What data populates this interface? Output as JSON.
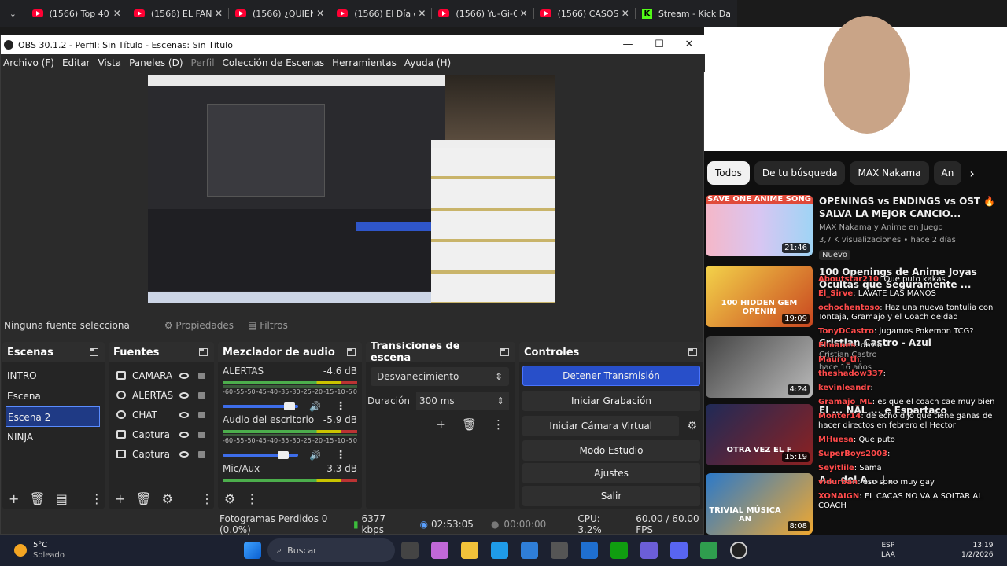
{
  "browser_tabs": [
    {
      "title": "(1566) Top 40 Op"
    },
    {
      "title": "(1566) EL FAN M"
    },
    {
      "title": "(1566) ¿QUIEN T"
    },
    {
      "title": "(1566) El Día que"
    },
    {
      "title": "(1566) Yu-Gi-Oh"
    },
    {
      "title": "(1566) CASOS O"
    },
    {
      "title": "Stream - Kick Da"
    }
  ],
  "obs": {
    "title": "OBS 30.1.2 - Perfil: Sin Título - Escenas: Sin Título",
    "menu": [
      "Archivo (F)",
      "Editar",
      "Vista",
      "Paneles (D)",
      "Perfil",
      "Colección de Escenas",
      "Herramientas",
      "Ayuda (H)"
    ],
    "no_source": "Ninguna fuente selecciona",
    "properties_label": "Propiedades",
    "filters_label": "Filtros",
    "scenes": {
      "title": "Escenas",
      "items": [
        "INTRO",
        "Escena",
        "Escena 2",
        "NINJA"
      ],
      "selected": "Escena 2"
    },
    "sources": {
      "title": "Fuentes",
      "items": [
        {
          "name": "CAMARA",
          "icon": "camera-icon"
        },
        {
          "name": "ALERTAS",
          "icon": "globe-icon"
        },
        {
          "name": "CHAT",
          "icon": "globe-icon"
        },
        {
          "name": "Captura d",
          "icon": "window-capture-icon"
        },
        {
          "name": "Captura d",
          "icon": "display-capture-icon"
        }
      ]
    },
    "mixer": {
      "title": "Mezclador de audio",
      "scale": [
        "-60",
        "-55",
        "-50",
        "-45",
        "-40",
        "-35",
        "-30",
        "-25",
        "-20",
        "-15",
        "-10",
        "-5",
        "0"
      ],
      "channels": [
        {
          "name": "ALERTAS",
          "db": "-4.6 dB",
          "level": 0.8
        },
        {
          "name": "Audio del escritorio",
          "db": "-5.9 dB",
          "level": 0.78
        },
        {
          "name": "Mic/Aux",
          "db": "-3.3 dB",
          "level": 0.0
        }
      ]
    },
    "transitions": {
      "title": "Transiciones de escena",
      "selected": "Desvanecimiento",
      "duration_label": "Duración",
      "duration_value": "300 ms"
    },
    "controls": {
      "title": "Controles",
      "buttons": [
        "Detener Transmisión",
        "Iniciar Grabación",
        "Iniciar Cámara Virtual",
        "Modo Estudio",
        "Ajustes",
        "Salir"
      ]
    },
    "status": {
      "dropped": "Fotogramas Perdidos 0 (0.0%)",
      "bitrate": "6377 kbps",
      "live_time": "02:53:05",
      "rec_time": "00:00:00",
      "cpu": "CPU: 3.2%",
      "fps": "60.00 / 60.00 FPS"
    }
  },
  "youtube": {
    "chips": [
      "Todos",
      "De tu búsqueda",
      "MAX Nakama",
      "An"
    ],
    "videos": [
      {
        "title": "OPENINGS vs ENDINGS vs OST 🔥 SALVA LA MEJOR CANCIO...",
        "channel": "MAX Nakama y Anime en Juego",
        "meta": "3,7 K visualizaciones • hace 2 días",
        "badge": "Nuevo",
        "duration": "21:46",
        "thumb_text": "SAVE ONE ANIME SONG"
      },
      {
        "title": "100 Openings de Anime Joyas Ocultas que Seguramente ...",
        "channel": "",
        "meta": "",
        "badge": "",
        "duration": "19:09",
        "thumb_text": "100 HIDDEN GEM OPENIN"
      },
      {
        "title": "Cristian Castro - Azul",
        "channel": "Cristian Castro",
        "meta": "hace 16 años",
        "badge": "",
        "duration": "4:24",
        "thumb_text": ""
      },
      {
        "title": "El ... NAL ... e Espartaco",
        "channel": "",
        "meta": "",
        "badge": "",
        "duration": "15:19",
        "thumb_text": "OTRA VEZ EL F"
      },
      {
        "title": "A... del A... | ...",
        "channel": "",
        "meta": "",
        "badge": "",
        "duration": "8:08",
        "thumb_text": "TRIVIAL MÚSICA AN"
      }
    ]
  },
  "chat": [
    {
      "user": "Aboutstar210",
      "text": "Que puto kakas"
    },
    {
      "user": "El_Sirve",
      "text": "LAVATE LAS MANOS"
    },
    {
      "user": "ochochentoso",
      "text": "Haz una nueva tontulia con Tontaja, Gramajo y el Coach deidad"
    },
    {
      "user": "TonyDCastro",
      "text": "jugamos Pokemon TCG?"
    },
    {
      "user": "Elmanes",
      "text": "obvio"
    },
    {
      "user": "Mauro_th",
      "text": ""
    },
    {
      "user": "theshadow337",
      "text": ""
    },
    {
      "user": "kevinleandr",
      "text": ""
    },
    {
      "user": "Gramajo_ML",
      "text": "es que el coach cae muy bien"
    },
    {
      "user": "Monter14",
      "text": "de echo dijo que tiene ganas de hacer directos en febrero el Hector"
    },
    {
      "user": "MHuesa",
      "text": "Que puto"
    },
    {
      "user": "SuperBoys2003",
      "text": ""
    },
    {
      "user": "Seyitlile",
      "text": "Sama"
    },
    {
      "user": "vidurban",
      "text": "eso sono muy gay"
    },
    {
      "user": "XONAIGN",
      "text": "EL CACAS NO VA A SOLTAR AL COACH"
    }
  ],
  "taskbar": {
    "weather_temp": "5°C",
    "weather_desc": "Soleado",
    "search_placeholder": "Buscar",
    "lang": "ESP",
    "lang2": "LAA",
    "time": "13:19",
    "date": "1/2/2026"
  }
}
